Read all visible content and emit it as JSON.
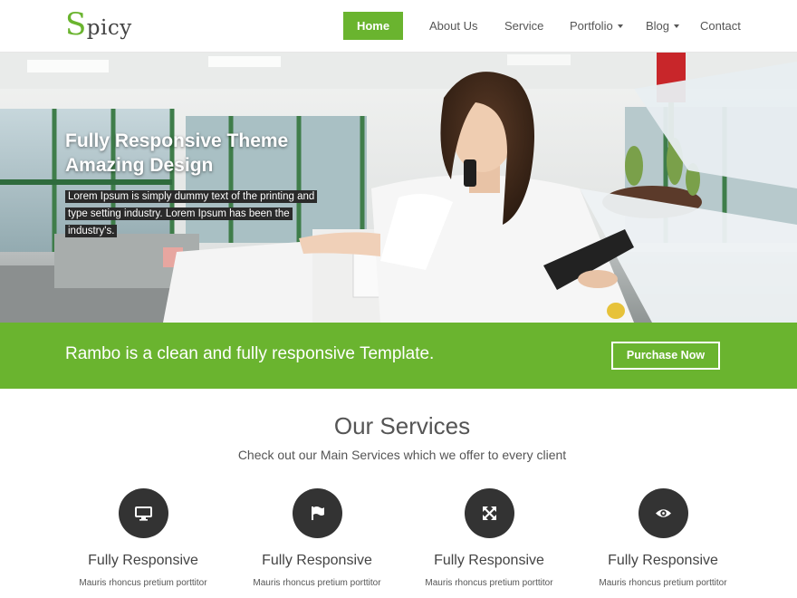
{
  "header": {
    "logo_initial": "S",
    "logo_rest": "picy",
    "nav": [
      {
        "label": "Home"
      },
      {
        "label": "About Us"
      },
      {
        "label": "Service"
      },
      {
        "label": "Portfolio"
      },
      {
        "label": "Blog"
      },
      {
        "label": "Contact"
      }
    ]
  },
  "hero": {
    "title_line1": "Fully Responsive Theme",
    "title_line2": "Amazing Design",
    "text": "Lorem Ipsum is simply dummy text of the printing and type setting industry. Lorem Ipsum has been the industry's."
  },
  "band": {
    "text": "Rambo is a clean and fully responsive Template.",
    "button": "Purchase Now"
  },
  "services": {
    "title": "Our Services",
    "subtitle": "Check out our Main Services which we offer to every client",
    "items": [
      {
        "icon": "monitor-icon",
        "name": "Fully Responsive",
        "desc": "Mauris rhoncus pretium porttitor"
      },
      {
        "icon": "flag-icon",
        "name": "Fully Responsive",
        "desc": "Mauris rhoncus pretium porttitor"
      },
      {
        "icon": "expand-icon",
        "name": "Fully Responsive",
        "desc": "Mauris rhoncus pretium porttitor"
      },
      {
        "icon": "eye-icon",
        "name": "Fully Responsive",
        "desc": "Mauris rhoncus pretium porttitor"
      }
    ]
  },
  "colors": {
    "brand_green": "#6ab42f",
    "dark_circle": "#333333"
  }
}
